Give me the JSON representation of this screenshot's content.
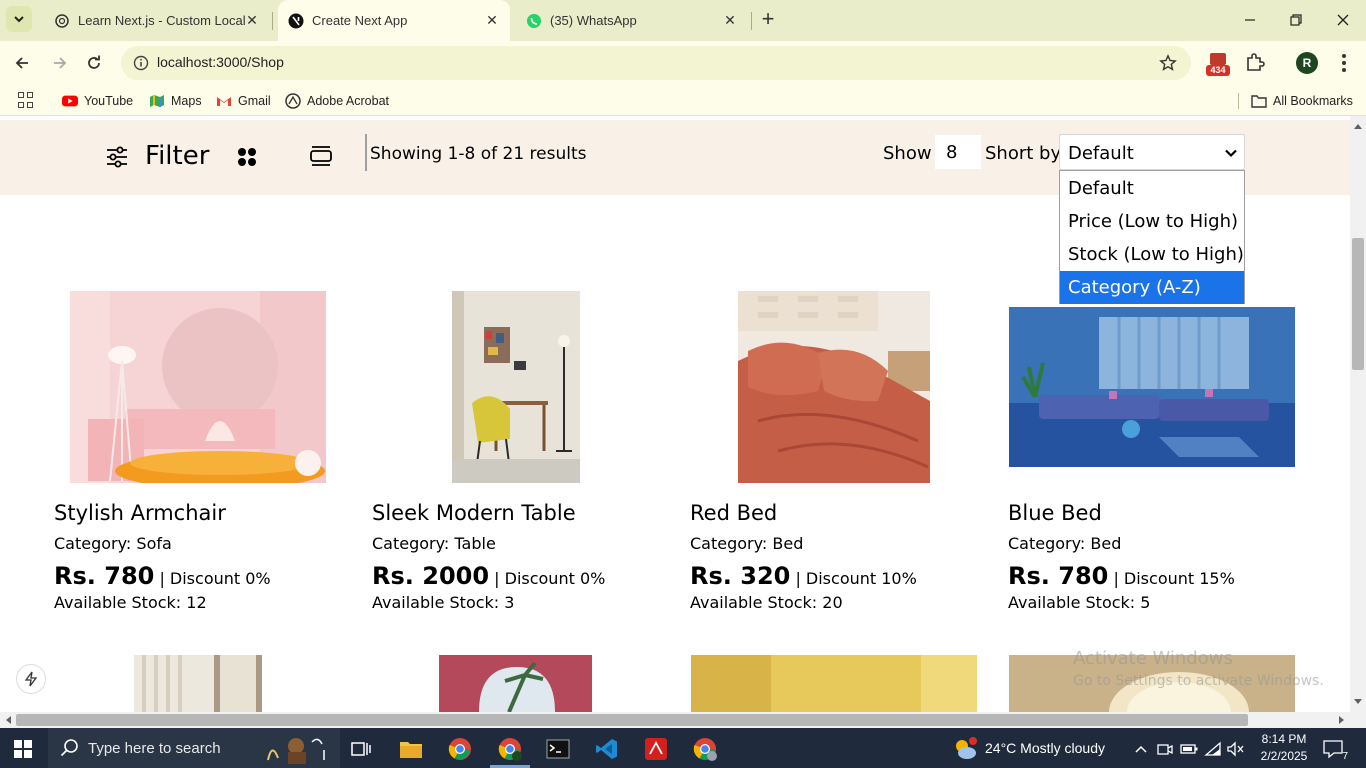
{
  "browser": {
    "tabs": [
      {
        "title": "Learn Next.js - Custom Localhost"
      },
      {
        "title": "Create Next App"
      },
      {
        "title": "(35) WhatsApp"
      }
    ],
    "url": "localhost:3000/Shop",
    "extension_badge": "434",
    "profile_initial": "R",
    "bookmarks": [
      {
        "label": "YouTube",
        "icon": "youtube-icon"
      },
      {
        "label": "Maps",
        "icon": "maps-icon"
      },
      {
        "label": "Gmail",
        "icon": "gmail-icon"
      },
      {
        "label": "Adobe Acrobat",
        "icon": "acrobat-icon"
      }
    ],
    "all_bookmarks": "All Bookmarks"
  },
  "shop": {
    "filter_label": "Filter",
    "results_text": "Showing 1-8 of 21 results",
    "show_label": "Show",
    "show_value": "8",
    "sort_label": "Short by",
    "sort_value": "Default",
    "sort_options": [
      "Default",
      "Price (Low to High)",
      "Stock (Low to High)",
      "Category (A-Z)"
    ],
    "sort_highlighted": "Category (A-Z)",
    "products": [
      {
        "name": "Stylish Armchair",
        "category_label": "Category:",
        "category": "Sofa",
        "price": "Rs. 780",
        "discount": "| Discount 0%",
        "stock": "Available Stock: 12"
      },
      {
        "name": "Sleek Modern Table",
        "category_label": "Category:",
        "category": "Table",
        "price": "Rs. 2000",
        "discount": "| Discount 0%",
        "stock": "Available Stock: 3"
      },
      {
        "name": "Red Bed",
        "category_label": "Category:",
        "category": "Bed",
        "price": "Rs. 320",
        "discount": "| Discount 10%",
        "stock": "Available Stock: 20"
      },
      {
        "name": "Blue Bed",
        "category_label": "Category:",
        "category": "Bed",
        "price": "Rs. 780",
        "discount": "| Discount 15%",
        "stock": "Available Stock: 5"
      }
    ]
  },
  "watermark": {
    "line1": "Activate Windows",
    "line2": "Go to Settings to activate Windows."
  },
  "taskbar": {
    "search_placeholder": "Type here to search",
    "weather": "24°C  Mostly cloudy",
    "time": "8:14 PM",
    "date": "2/2/2025",
    "notification_count": "7"
  },
  "colors": {
    "tab_strip": "#e9edc9",
    "toolbar": "#fdfde9",
    "filter_bar": "#f9f1e7",
    "dropdown_highlight": "#1a73e8",
    "taskbar": "#1f2b3d"
  }
}
